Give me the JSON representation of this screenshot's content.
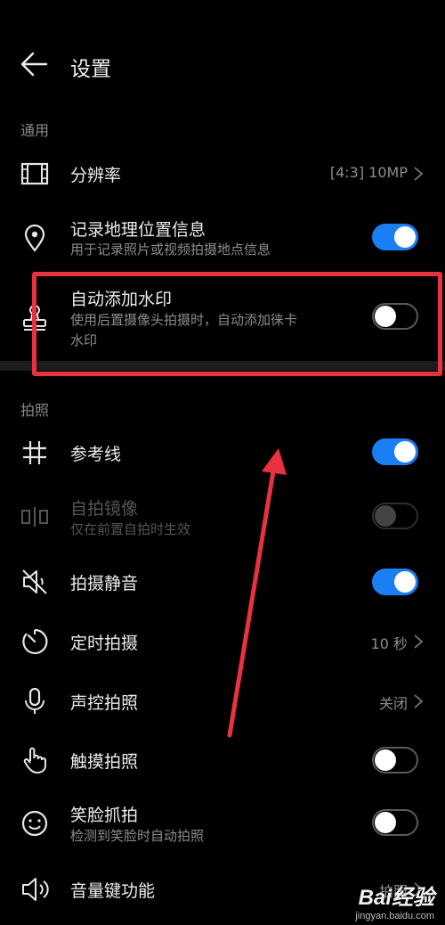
{
  "header": {
    "title": "设置"
  },
  "sections": {
    "general": "通用",
    "photo": "拍照"
  },
  "rows": {
    "resolution": {
      "label": "分辨率",
      "value": "[4:3] 10MP"
    },
    "location": {
      "label": "记录地理位置信息",
      "sub": "用于记录照片或视频拍摄地点信息",
      "on": true
    },
    "watermark": {
      "label": "自动添加水印",
      "sub1": "使用后置摄像头拍摄时，自动添加徕卡",
      "sub2": "水印",
      "on": false
    },
    "gridline": {
      "label": "参考线",
      "on": true
    },
    "mirror": {
      "label": "自拍镜像",
      "sub": "仅在前置自拍时生效",
      "on": false,
      "disabled": true
    },
    "mute": {
      "label": "拍摄静音",
      "on": true
    },
    "timer": {
      "label": "定时拍摄",
      "value": "10 秒"
    },
    "voice": {
      "label": "声控拍照",
      "value": "关闭"
    },
    "touch": {
      "label": "触摸拍照",
      "on": false
    },
    "smile": {
      "label": "笑脸抓拍",
      "sub": "检测到笑脸时自动拍照",
      "on": false
    },
    "volume": {
      "label": "音量键功能",
      "value": "拍照"
    }
  },
  "watermark_overlay": {
    "logo": "Bai经验",
    "url": "jingyan.baidu.com"
  },
  "colors": {
    "accent": "#1a7ff2",
    "annotation": "#e8323f"
  }
}
